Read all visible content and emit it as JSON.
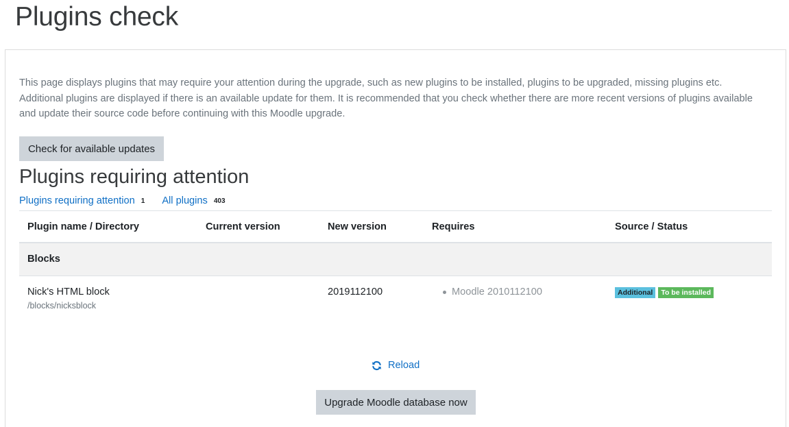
{
  "page": {
    "title": "Plugins check"
  },
  "intro": "This page displays plugins that may require your attention during the upgrade, such as new plugins to be installed, plugins to be upgraded, missing plugins etc. Additional plugins are displayed if there is an available update for them. It is recommended that you check whether there are more recent versions of plugins available and update their source code before continuing with this Moodle upgrade.",
  "check_button": "Check for available updates",
  "section_title": "Plugins requiring attention",
  "filters": [
    {
      "label": "Plugins requiring attention",
      "count": "1"
    },
    {
      "label": "All plugins",
      "count": "403"
    }
  ],
  "table": {
    "headers": [
      "Plugin name / Directory",
      "Current version",
      "New version",
      "Requires",
      "Source / Status"
    ],
    "groups": [
      {
        "name": "Blocks",
        "rows": [
          {
            "name": "Nick's HTML block",
            "directory": "/blocks/nicksblock",
            "current_version": "",
            "new_version": "2019112100",
            "requires": "Moodle 2010112100",
            "badges": [
              "Additional",
              "To be installed"
            ]
          }
        ]
      }
    ]
  },
  "reload": {
    "label": "Reload",
    "icon": "refresh-icon"
  },
  "upgrade_button": "Upgrade Moodle database now",
  "colors": {
    "link": "#0f6fc5",
    "badge_additional": "#5bc0de",
    "badge_install": "#5cb85c",
    "button": "#ced4da"
  }
}
